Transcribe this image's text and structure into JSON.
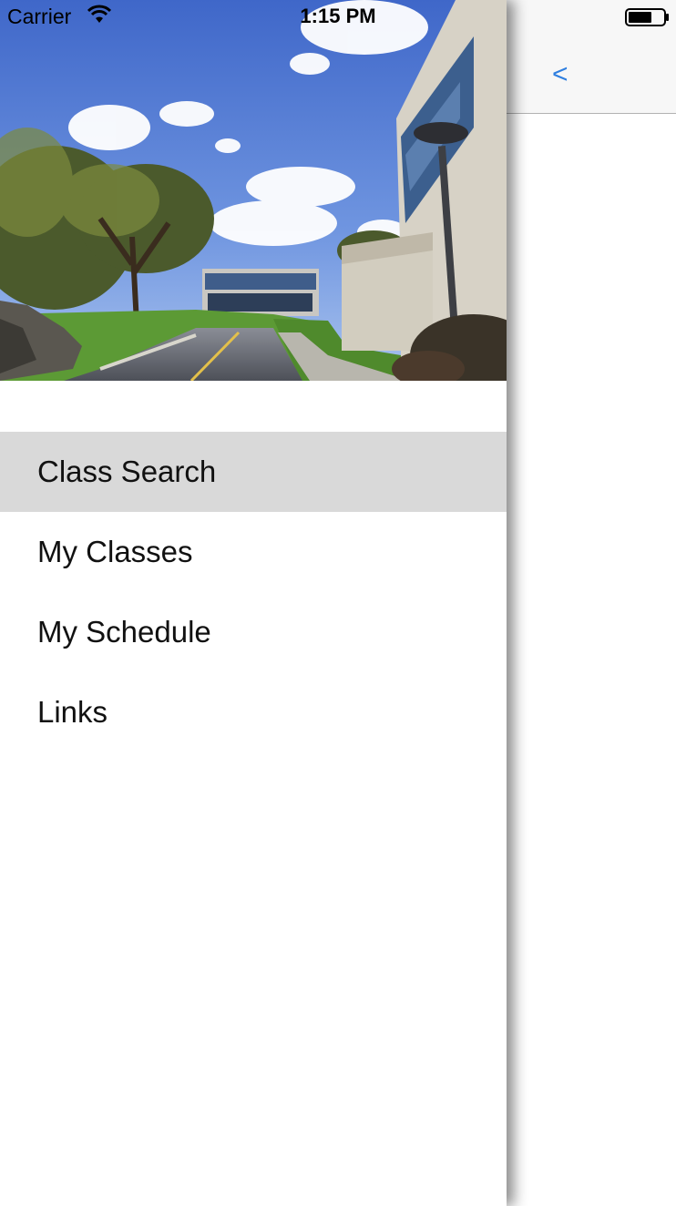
{
  "status_bar": {
    "carrier": "Carrier",
    "time": "1:15 PM"
  },
  "navbar": {
    "back_label": "<"
  },
  "drawer": {
    "hero_image": "campus-photo",
    "menu": [
      {
        "label": "Class Search",
        "selected": true
      },
      {
        "label": "My Classes",
        "selected": false
      },
      {
        "label": "My Schedule",
        "selected": false
      },
      {
        "label": "Links",
        "selected": false
      }
    ]
  },
  "colors": {
    "accent": "#2f7fe0",
    "selected_row": "#d9d9d9",
    "navbar_bg": "#f7f7f7"
  }
}
